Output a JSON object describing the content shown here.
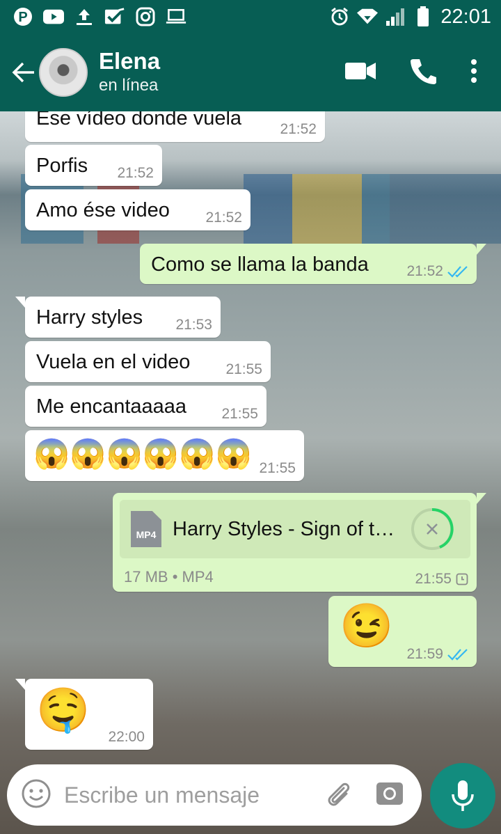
{
  "status_bar": {
    "time": "22:01"
  },
  "header": {
    "name": "Elena",
    "status": "en línea"
  },
  "messages": [
    {
      "text": "Ese vídeo donde vuela",
      "time": "21:52"
    },
    {
      "text": "Porfis",
      "time": "21:52"
    },
    {
      "text": "Amo ése video",
      "time": "21:52"
    },
    {
      "text": "Como se llama la banda",
      "time": "21:52"
    },
    {
      "text": "Harry styles",
      "time": "21:53"
    },
    {
      "text": "Vuela en el video",
      "time": "21:55"
    },
    {
      "text": "Me encantaaaaa",
      "time": "21:55"
    },
    {
      "text": "😱😱😱😱😱😱",
      "time": "21:55"
    },
    {
      "file_name": "Harry Styles - Sign of t…",
      "file_type": "MP4",
      "size": "17 MB",
      "meta": "17 MB • MP4",
      "time": "21:55"
    },
    {
      "text": "😉",
      "time": "21:59"
    },
    {
      "text": "🤤",
      "time": "22:00"
    }
  ],
  "composer": {
    "placeholder": "Escribe un mensaje"
  },
  "colors": {
    "header": "#075e54",
    "outgoing": "#dcf8c6",
    "incoming": "#ffffff",
    "read_ticks": "#34b7f1",
    "mic": "#128c7e",
    "progress": "#25d366"
  }
}
